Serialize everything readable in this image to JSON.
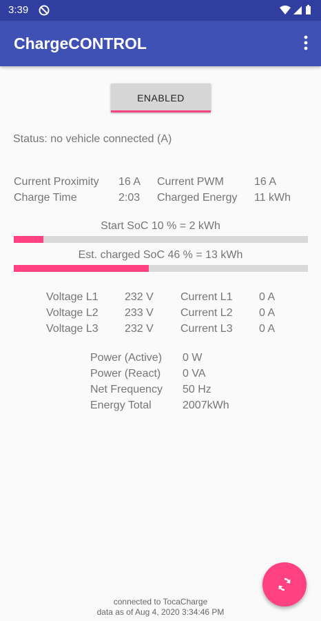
{
  "statusbar": {
    "time": "3:39"
  },
  "appbar": {
    "title": "ChargeCONTROL",
    "menu_icon": "more-vert-icon"
  },
  "enable_button": {
    "label": "ENABLED"
  },
  "status": {
    "text": "Status: no vehicle connected (A)"
  },
  "summary": {
    "current_proximity_label": "Current Proximity",
    "current_proximity_value": "16 A",
    "current_pwm_label": "Current PWM",
    "current_pwm_value": "16 A",
    "charge_time_label": "Charge Time",
    "charge_time_value": "2:03",
    "charged_energy_label": "Charged Energy",
    "charged_energy_value": "11 kWh"
  },
  "start_soc": {
    "label": "Start SoC 10 % = 2 kWh",
    "percent": 10
  },
  "est_soc": {
    "label": "Est. charged SoC 46 % = 13 kWh",
    "percent": 46
  },
  "phases": [
    {
      "voltage_label": "Voltage L1",
      "voltage": "232 V",
      "current_label": "Current L1",
      "current": "0 A"
    },
    {
      "voltage_label": "Voltage L2",
      "voltage": "233 V",
      "current_label": "Current L2",
      "current": "0 A"
    },
    {
      "voltage_label": "Voltage L3",
      "voltage": "232 V",
      "current_label": "Current L3",
      "current": "0 A"
    }
  ],
  "power": [
    {
      "label": "Power (Active)",
      "value": "0 W"
    },
    {
      "label": "Power (React)",
      "value": "0 VA"
    },
    {
      "label": "Net Frequency",
      "value": "50 Hz"
    },
    {
      "label": "Energy Total",
      "value": "2007kWh"
    }
  ],
  "fab": {
    "icon": "refresh-icon"
  },
  "footer": {
    "line1": "connected to TocaCharge",
    "line2": "data as of Aug 4, 2020 3:34:46 PM"
  },
  "colors": {
    "primary": "#3f51b5",
    "primary_dark": "#303f9f",
    "accent": "#ff4081"
  }
}
